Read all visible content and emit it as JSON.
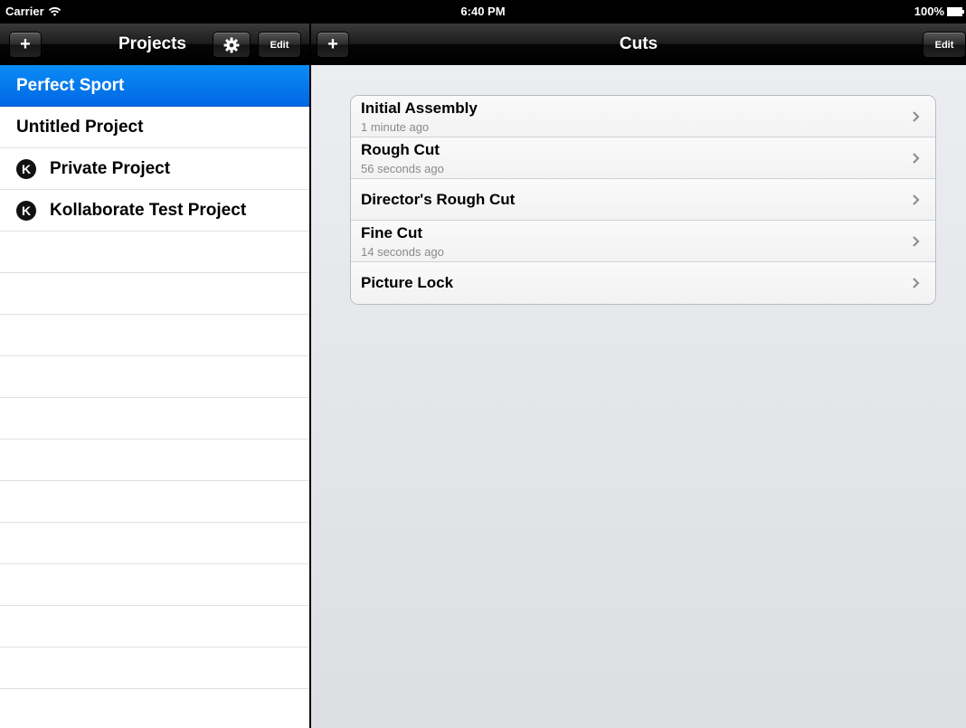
{
  "status_bar": {
    "carrier": "Carrier",
    "time": "6:40 PM",
    "battery": "100%"
  },
  "projects_pane": {
    "title": "Projects",
    "add_label": "+",
    "settings_icon": "gear-icon",
    "edit_label": "Edit",
    "items": [
      {
        "label": "Perfect Sport",
        "selected": true,
        "badge": ""
      },
      {
        "label": "Untitled Project",
        "selected": false,
        "badge": ""
      },
      {
        "label": "Private Project",
        "selected": false,
        "badge": "K"
      },
      {
        "label": "Kollaborate Test Project",
        "selected": false,
        "badge": "K"
      }
    ]
  },
  "cuts_pane": {
    "title": "Cuts",
    "add_label": "+",
    "edit_label": "Edit",
    "items": [
      {
        "title": "Initial Assembly",
        "subtitle": "1 minute ago"
      },
      {
        "title": "Rough Cut",
        "subtitle": "56 seconds ago"
      },
      {
        "title": "Director's Rough Cut",
        "subtitle": ""
      },
      {
        "title": "Fine Cut",
        "subtitle": "14 seconds ago"
      },
      {
        "title": "Picture Lock",
        "subtitle": ""
      }
    ]
  },
  "colors": {
    "selection": "#0a7cf0",
    "navbar": "#111111",
    "detail_background": "#e4e6e9"
  }
}
